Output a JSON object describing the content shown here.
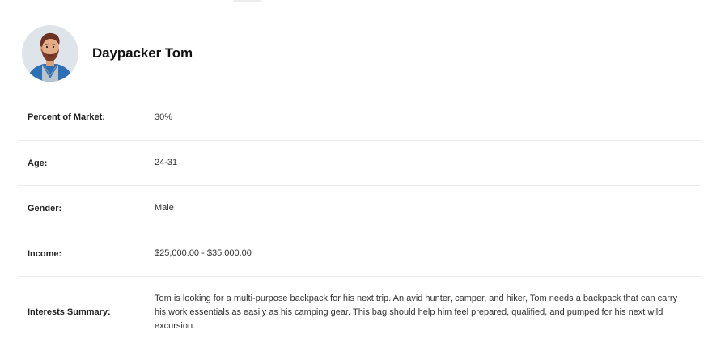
{
  "persona": {
    "name": "Daypacker Tom",
    "avatar_icon": "man-with-beard-avatar"
  },
  "details": [
    {
      "label": "Percent of Market:",
      "value": "30%"
    },
    {
      "label": "Age:",
      "value": "24-31"
    },
    {
      "label": "Gender:",
      "value": "Male"
    },
    {
      "label": "Income:",
      "value": "$25,000.00 - $35,000.00"
    },
    {
      "label": "Interests Summary:",
      "value": "Tom is looking for a multi-purpose backpack for his next trip. An avid hunter, camper, and hiker, Tom needs a backpack that can carry his work essentials as easily as his camping gear. This bag should help him feel prepared, qualified, and pumped for his next wild excursion."
    }
  ]
}
